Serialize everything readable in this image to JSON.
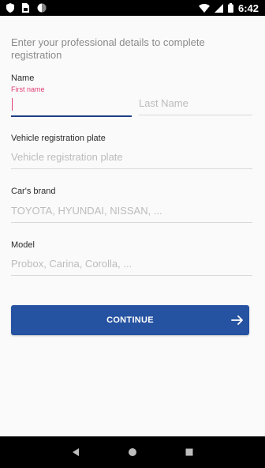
{
  "status_bar": {
    "time": "6:42",
    "icons": [
      "shield-icon",
      "sim-card-icon",
      "circle-icon",
      "wifi-icon",
      "signal-icon",
      "battery-icon"
    ]
  },
  "form": {
    "intro_text": "Enter your professional details to complete registration",
    "name_label": "Name",
    "first_name_label": "First name",
    "first_name_value": "",
    "last_name_placeholder": "Last Name",
    "plate_label": "Vehicle registration plate",
    "plate_placeholder": "Vehicle registration plate",
    "brand_label": "Car's brand",
    "brand_placeholder": "TOYOTA, HYUNDAI, NISSAN, ...",
    "model_label": "Model",
    "model_placeholder": "Probox, Carina, Corolla, ...",
    "continue_label": "CONTINUE"
  },
  "nav_bar": {
    "icons": [
      "back-icon",
      "home-icon",
      "recents-icon"
    ]
  },
  "colors": {
    "accent": "#2653a1",
    "focus_underline": "#1f3f86",
    "floating_label": "#e0427a",
    "status_bar": "#000000"
  }
}
